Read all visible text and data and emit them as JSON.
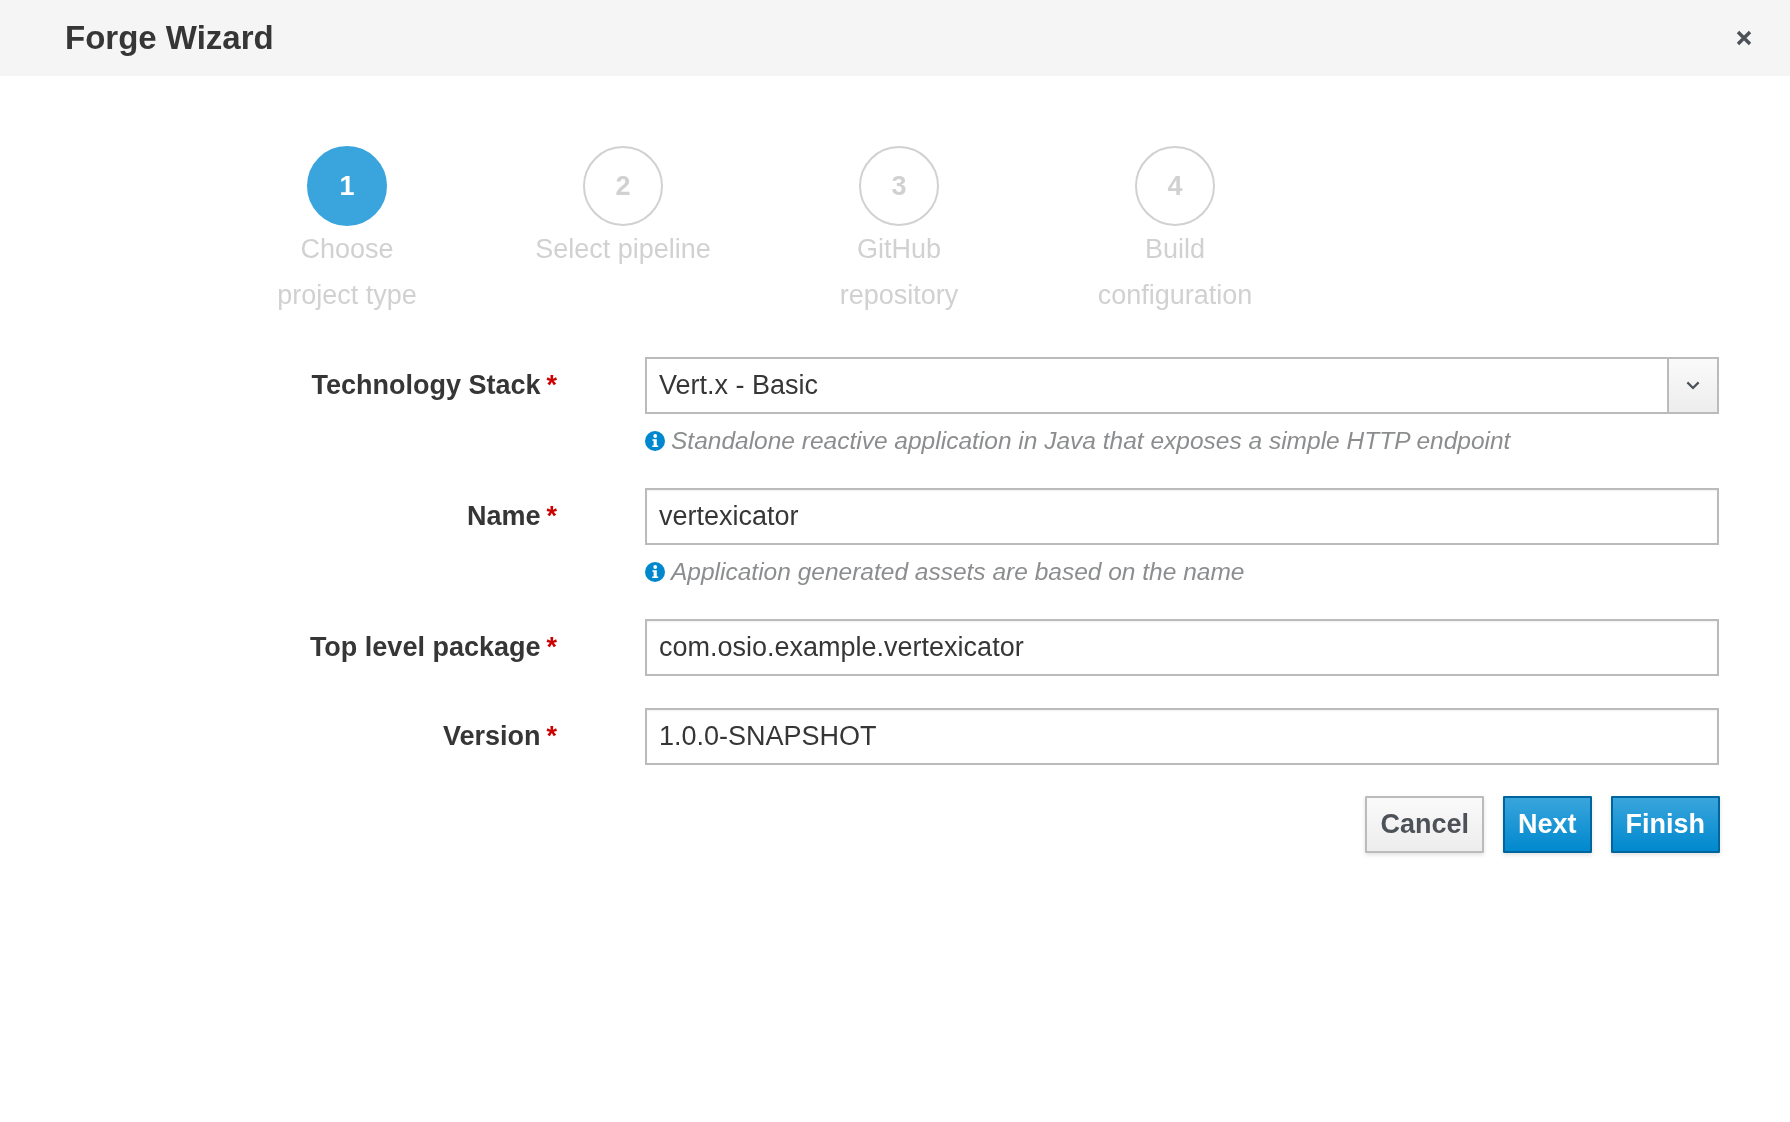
{
  "window": {
    "title": "Forge Wizard"
  },
  "steps": [
    {
      "number": "1",
      "label": "Choose project type",
      "selected": true
    },
    {
      "number": "2",
      "label": "Select pipeline",
      "selected": false
    },
    {
      "number": "3",
      "label": "GitHub repository",
      "selected": false
    },
    {
      "number": "4",
      "label": "Build configuration",
      "selected": false
    }
  ],
  "fields": [
    {
      "kind": "select",
      "label": "Technology Stack",
      "required_marker": "*",
      "value": "Vert.x - Basic",
      "help": "Standalone reactive application in Java that exposes a simple HTTP endpoint"
    },
    {
      "kind": "text",
      "label": "Name",
      "required_marker": "*",
      "value": "vertexicator",
      "help": "Application generated assets are based on the name"
    },
    {
      "kind": "text",
      "label": "Top level package",
      "required_marker": "*",
      "value": "com.osio.example.vertexicator"
    },
    {
      "kind": "text",
      "label": "Version",
      "required_marker": "*",
      "value": "1.0.0-SNAPSHOT"
    }
  ],
  "buttons": [
    {
      "kind": "default",
      "label": "Cancel"
    },
    {
      "kind": "primary",
      "label": "Next"
    },
    {
      "kind": "primary",
      "label": "Finish"
    }
  ]
}
